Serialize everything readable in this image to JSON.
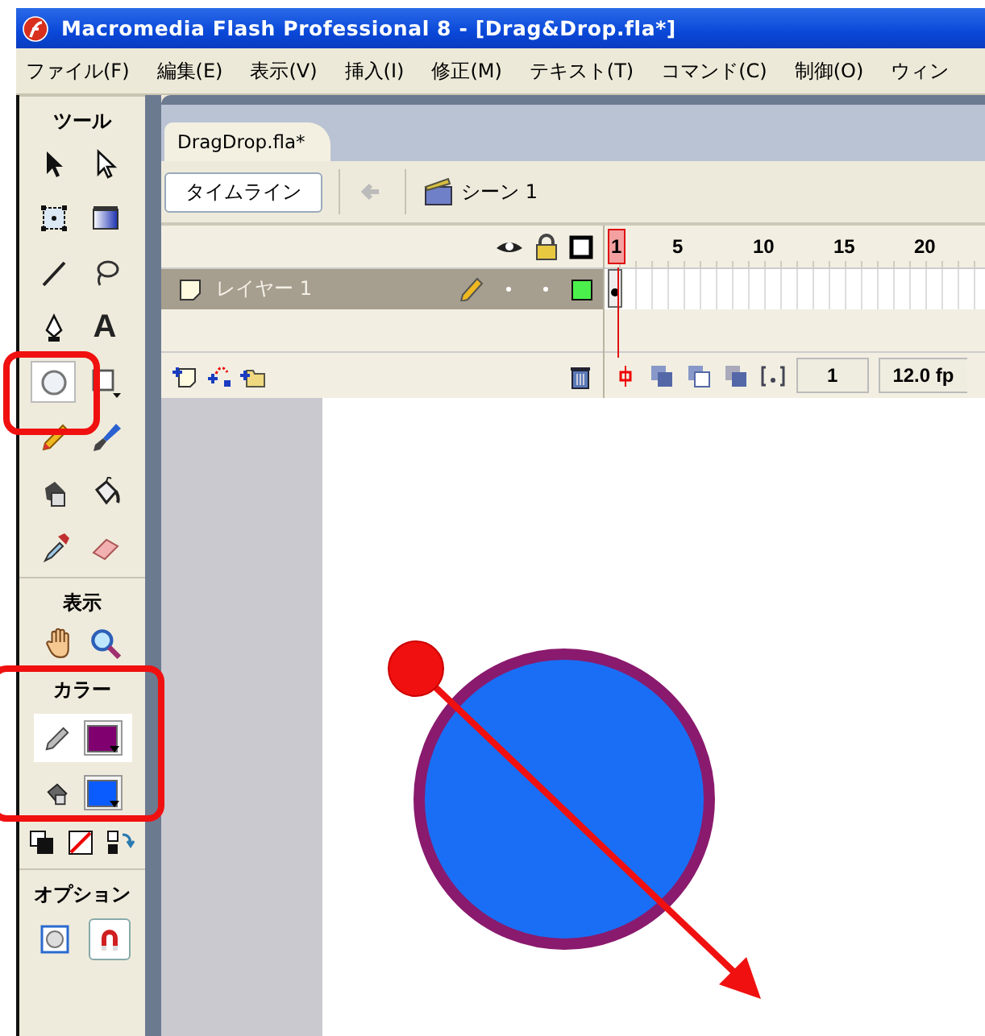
{
  "window": {
    "title": "Macromedia Flash Professional 8 - [Drag&Drop.fla*]"
  },
  "menu": [
    "ファイル(F)",
    "編集(E)",
    "表示(V)",
    "挿入(I)",
    "修正(M)",
    "テキスト(T)",
    "コマンド(C)",
    "制御(O)",
    "ウィン"
  ],
  "tools": {
    "title": "ツール",
    "items": [
      {
        "kind": "arrow",
        "selected": false
      },
      {
        "kind": "subselect",
        "selected": false
      },
      {
        "kind": "free-transform",
        "selected": false
      },
      {
        "kind": "gradient-transform",
        "selected": false
      },
      {
        "kind": "line",
        "selected": false
      },
      {
        "kind": "lasso",
        "selected": false
      },
      {
        "kind": "pen",
        "selected": false
      },
      {
        "kind": "text",
        "selected": false,
        "label": "A"
      },
      {
        "kind": "oval",
        "selected": true
      },
      {
        "kind": "rectangle",
        "selected": false
      },
      {
        "kind": "pencil",
        "selected": false
      },
      {
        "kind": "brush",
        "selected": false
      },
      {
        "kind": "ink-bottle",
        "selected": false
      },
      {
        "kind": "paint-bucket",
        "selected": false
      },
      {
        "kind": "eyedropper",
        "selected": false
      },
      {
        "kind": "eraser",
        "selected": false
      }
    ]
  },
  "view": {
    "title": "表示"
  },
  "colors": {
    "title": "カラー",
    "swatches": [
      {
        "kind": "stroke",
        "color": "#800070",
        "selected": true
      },
      {
        "kind": "fill",
        "color": "#0a5cff",
        "selected": false
      }
    ]
  },
  "options": {
    "title": "オプション"
  },
  "document": {
    "tab": "DragDrop.fla*",
    "timeline_button": "タイムライン",
    "scene": "シーン 1",
    "frame_numbers": [
      "1",
      "5",
      "10",
      "15",
      "20"
    ],
    "layers": [
      {
        "name": "レイヤー 1",
        "selected": true
      }
    ],
    "current_frame": "1",
    "frame_rate": "12.0 fp"
  }
}
